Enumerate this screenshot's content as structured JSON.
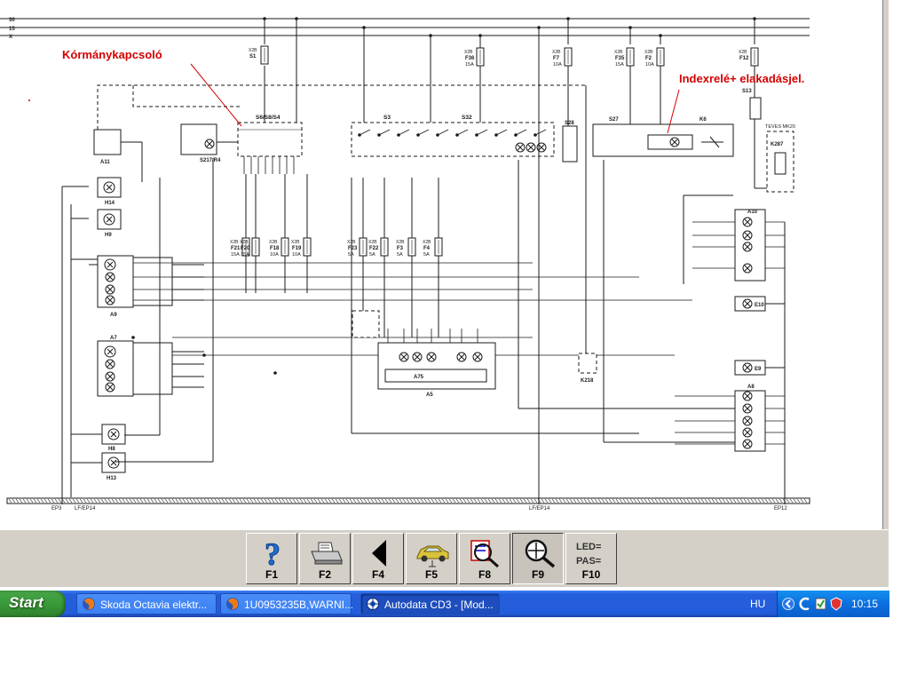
{
  "diagram": {
    "rails": [
      "30",
      "15",
      "X"
    ],
    "annotations": [
      "Kórmánykapcsoló",
      "Indexrelé+ elakadásjel."
    ],
    "components": [
      "A11",
      "S217/R4",
      "S6/S8/S4",
      "S3",
      "S32",
      "S28",
      "S27",
      "K6",
      "S13",
      "TEVES MK20",
      "K287",
      "H14",
      "H9",
      "A9",
      "A7",
      "H8",
      "H13",
      "A10",
      "E10",
      "E9",
      "A8",
      "A75",
      "A5",
      "K218"
    ],
    "fuses": [
      {
        "id": "S1"
      },
      {
        "id": "F36",
        "rating": "15A"
      },
      {
        "id": "F7",
        "rating": "10A"
      },
      {
        "id": "F35",
        "rating": "15A"
      },
      {
        "id": "F2",
        "rating": "10A"
      },
      {
        "id": "F12"
      },
      {
        "id": "F21",
        "rating": "15A"
      },
      {
        "id": "F20",
        "rating": "15A"
      },
      {
        "id": "F18",
        "rating": "10A"
      },
      {
        "id": "F19",
        "rating": "10A"
      },
      {
        "id": "F23",
        "rating": "5A"
      },
      {
        "id": "F22",
        "rating": "5A"
      },
      {
        "id": "F3",
        "rating": "5A"
      },
      {
        "id": "F4",
        "rating": "5A"
      }
    ],
    "ground_labels": [
      "EP3",
      "LF/EP14",
      "LF/EP14",
      "EP12"
    ],
    "accent_red": "#d40000",
    "line_color": "#1a1a1a"
  },
  "function_keys": [
    {
      "label": "F1",
      "icon": "help-question-icon"
    },
    {
      "label": "F2",
      "icon": "printer-icon"
    },
    {
      "label": "F4",
      "icon": "back-arrow-icon"
    },
    {
      "label": "F5",
      "icon": "vehicle-icon"
    },
    {
      "label": "F8",
      "icon": "component-locate-icon"
    },
    {
      "label": "F9",
      "icon": "zoom-icon",
      "active": true
    },
    {
      "label": "F10",
      "icon": "led-pas-icon",
      "icon_text_1": "LED=",
      "icon_text_2": "PAS="
    }
  ],
  "taskbar": {
    "start_label": "Start",
    "tasks": [
      {
        "label": "Skoda Octavia elektr...",
        "icon": "firefox-icon",
        "active": false
      },
      {
        "label": "1U0953235B,WARNI...",
        "icon": "firefox-icon",
        "active": false
      },
      {
        "label": "Autodata CD3 - [Mod...",
        "icon": "autodata-icon",
        "active": true
      }
    ],
    "language": "HU",
    "clock": "10:15",
    "tray_icons": [
      "arrow-left-icon",
      "network-icon",
      "volume-icon",
      "security-icon"
    ]
  }
}
